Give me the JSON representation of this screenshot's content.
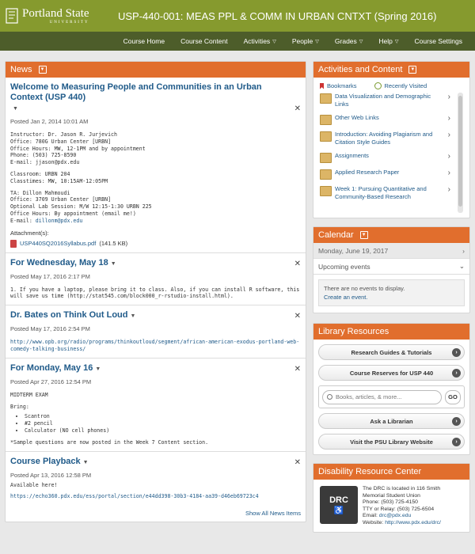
{
  "header": {
    "logo_line1": "Portland State",
    "logo_line2": "UNIVERSITY",
    "course_title": "USP-440-001: MEAS PPL & COMM IN URBAN CNTXT (Spring 2016)"
  },
  "nav": [
    {
      "label": "Course Home"
    },
    {
      "label": "Course Content"
    },
    {
      "label": "Activities",
      "dropdown": true
    },
    {
      "label": "People",
      "dropdown": true
    },
    {
      "label": "Grades",
      "dropdown": true
    },
    {
      "label": "Help",
      "dropdown": true
    },
    {
      "label": "Course Settings"
    }
  ],
  "news": {
    "title": "News",
    "items": [
      {
        "title": "Welcome to Measuring People and Communities in an Urban Context (USP 440)",
        "posted": "Posted Jan 2, 2014 10:01 AM",
        "lines1": [
          "Instructor:  Dr. Jason R. Jurjevich",
          "Office:  780G Urban Center [URBN]",
          "Office Hours:  MW, 12-1PM and by appointment",
          "Phone:  (503) 725-8590",
          "E-mail:  jjason@pdx.edu"
        ],
        "lines2": [
          "Classroom:  URBN 204",
          "Classtimes:  MW, 10:15AM-12:05PM"
        ],
        "lines3": [
          "TA: Dillon Mahmoudi",
          "Office: 3709 Urban Center [URBN]",
          "Optional Lab Session: M/W 12:15-1:30 URBN 225",
          "Office Hours: By appointment (email me!)"
        ],
        "email_label": "E-mail: ",
        "email": "dillonm@pdx.edu",
        "attachments_label": "Attachment(s):",
        "attachment_name": "USP440SQ2016Syllabus.pdf",
        "attachment_size": "(141.5 KB)"
      },
      {
        "title": "For Wednesday, May 18",
        "posted": "Posted May 17, 2016 2:17 PM",
        "body": "1.  If you have a laptop, please bring it to class.  Also, if you can install R software, this will save us time (http://stat545.com/block000_r-rstudio-install.html)."
      },
      {
        "title": "Dr. Bates on Think Out Loud",
        "posted": "Posted May 17, 2016 2:54 PM",
        "link": "http://www.opb.org/radio/programs/thinkoutloud/segment/african-american-exodus-portland-web-comedy-talking-business/"
      },
      {
        "title": "For Monday, May 16",
        "posted": "Posted Apr 27, 2016 12:54 PM",
        "heading": "MIDTERM EXAM",
        "bring_label": "Bring:",
        "bring": [
          "Scantron",
          "#2 pencil",
          "Calculator (NO cell phones)"
        ],
        "note": "*Sample questions are now posted in the Week 7 Content section."
      },
      {
        "title": "Course Playback",
        "posted": "Posted Apr 13, 2016 12:58 PM",
        "body": "Available here!",
        "link": "https://echo360.pdx.edu/ess/portal/section/e44dd398-30b3-4184-aa39-d46eb69723c4"
      }
    ],
    "show_all": "Show All News Items"
  },
  "activities": {
    "title": "Activities and Content",
    "bookmarks": "Bookmarks",
    "recently_visited": "Recently Visited",
    "items": [
      {
        "label": "Data Visualization and Demographic Links"
      },
      {
        "label": "Other Web Links"
      },
      {
        "label": "Introduction: Avoiding Plagiarism and Citation Style Guides"
      },
      {
        "label": "Assignments"
      },
      {
        "label": "Applied Research Paper"
      },
      {
        "label": "Week 1: Pursuing Quantitative and Community-Based Research"
      }
    ]
  },
  "calendar": {
    "title": "Calendar",
    "date": "Monday, June 19, 2017",
    "upcoming": "Upcoming events",
    "no_events": "There are no events to display.",
    "create": "Create an event."
  },
  "library": {
    "title": "Library Resources",
    "btn1": "Research Guides & Tutorials",
    "btn2": "Course Reserves for USP 440",
    "search_placeholder": "Books, articles, & more...",
    "go": "GO",
    "btn3": "Ask a Librarian",
    "btn4": "Visit the PSU Library Website"
  },
  "drc": {
    "title": "Disability Resource Center",
    "logo_text": "DRC",
    "lines": [
      "The DRC is located in 116 Smith",
      "Memorial Student Union",
      "Phone: (503) 725-4150",
      "TTY or Relay: (503) 725-6504"
    ],
    "email_label": "Email: ",
    "email": "drc@pdx.edu",
    "website_label": "Website: ",
    "website": "http://www.pdx.edu/drc/"
  },
  "colors": {
    "header": "#869a2e",
    "nav": "#4d5d2a",
    "panel_head": "#e16e2d",
    "link": "#1f5a89"
  }
}
